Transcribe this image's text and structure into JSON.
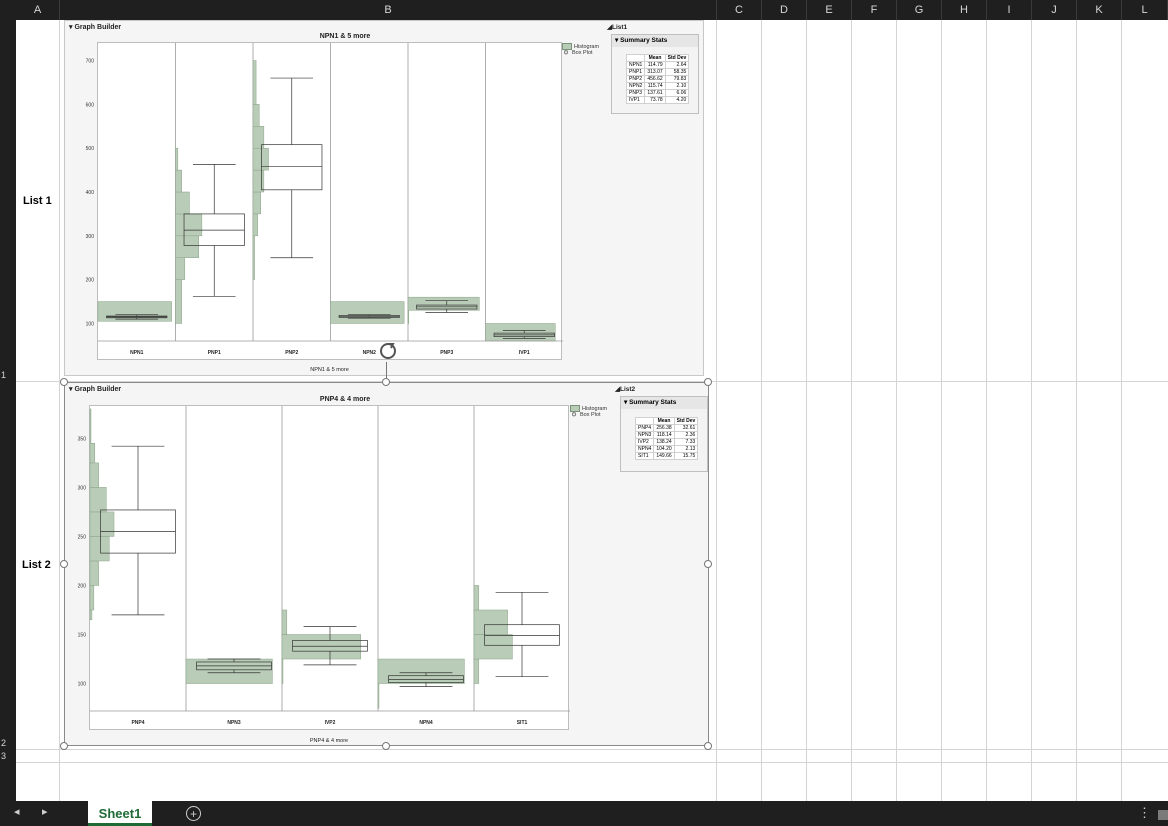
{
  "spreadsheet": {
    "columns": [
      "A",
      "B",
      "C",
      "D",
      "E",
      "F",
      "G",
      "H",
      "I",
      "J",
      "K",
      "L"
    ],
    "rows": [
      "1",
      "2",
      "3"
    ],
    "row_labels": [
      "List 1",
      "List 2"
    ],
    "sheet_tab": "Sheet1"
  },
  "panel1": {
    "header": "Graph Builder",
    "title": "NPN1 & 5 more",
    "footer": "NPN1 & 5 more",
    "legend": [
      "Histogram",
      "Box Plot"
    ],
    "list_label": "List1",
    "stats_title": "Summary Stats",
    "stats_headers": [
      "",
      "Mean",
      "Std Dev"
    ],
    "stats_rows": [
      [
        "NPN1",
        "114.79",
        "2.64"
      ],
      [
        "PNP1",
        "313.07",
        "58.35"
      ],
      [
        "PNP2",
        "456.62",
        "79.83"
      ],
      [
        "NPN2",
        "115.74",
        "2.10"
      ],
      [
        "PNP3",
        "137.61",
        "6.06"
      ],
      [
        "IVP1",
        "73.78",
        "4.20"
      ]
    ]
  },
  "panel2": {
    "header": "Graph Builder",
    "title": "PNP4 & 4 more",
    "footer": "PNP4 & 4 more",
    "legend": [
      "Histogram",
      "Box Plot"
    ],
    "list_label": "List2",
    "stats_title": "Summary Stats",
    "stats_headers": [
      "",
      "Mean",
      "Std Dev"
    ],
    "stats_rows": [
      [
        "PNP4",
        "256.38",
        "32.61"
      ],
      [
        "NPN3",
        "118.14",
        "2.36"
      ],
      [
        "IVP2",
        "138.24",
        "7.33"
      ],
      [
        "NPN4",
        "104.20",
        "2.13"
      ],
      [
        "SIT1",
        "149.66",
        "15.75"
      ]
    ]
  },
  "chart_data": [
    {
      "type": "box",
      "title": "NPN1 & 5 more",
      "xlabel": "NPN1 & 5 more",
      "ylabel": "",
      "ylim": [
        60,
        740
      ],
      "yticks": [
        100,
        200,
        300,
        400,
        500,
        600,
        700
      ],
      "legend": [
        "Histogram",
        "Box Plot"
      ],
      "legend_position": "top-right",
      "categories": [
        "NPN1",
        "PNP1",
        "PNP2",
        "NPN2",
        "PNP3",
        "IVP1"
      ],
      "boxes": [
        {
          "name": "NPN1",
          "min": 110,
          "q1": 113,
          "median": 115,
          "q3": 117,
          "max": 120
        },
        {
          "name": "PNP1",
          "min": 162,
          "q1": 278,
          "median": 313,
          "q3": 350,
          "max": 463
        },
        {
          "name": "PNP2",
          "min": 250,
          "q1": 405,
          "median": 458,
          "q3": 508,
          "max": 660
        },
        {
          "name": "NPN2",
          "min": 112,
          "q1": 114,
          "median": 116,
          "q3": 118,
          "max": 120
        },
        {
          "name": "PNP3",
          "min": 125,
          "q1": 133,
          "median": 138,
          "q3": 142,
          "max": 152
        },
        {
          "name": "IVP1",
          "min": 66,
          "q1": 70,
          "median": 74,
          "q3": 78,
          "max": 84
        }
      ],
      "histograms": [
        {
          "name": "NPN1",
          "bins": [
            {
              "lo": 105,
              "hi": 150,
              "w": 0.95
            }
          ]
        },
        {
          "name": "PNP1",
          "bins": [
            {
              "lo": 100,
              "hi": 200,
              "w": 0.08
            },
            {
              "lo": 200,
              "hi": 250,
              "w": 0.12
            },
            {
              "lo": 250,
              "hi": 300,
              "w": 0.3
            },
            {
              "lo": 300,
              "hi": 350,
              "w": 0.34
            },
            {
              "lo": 350,
              "hi": 400,
              "w": 0.18
            },
            {
              "lo": 400,
              "hi": 450,
              "w": 0.08
            },
            {
              "lo": 450,
              "hi": 500,
              "w": 0.03
            }
          ]
        },
        {
          "name": "PNP2",
          "bins": [
            {
              "lo": 200,
              "hi": 300,
              "w": 0.02
            },
            {
              "lo": 300,
              "hi": 350,
              "w": 0.06
            },
            {
              "lo": 350,
              "hi": 400,
              "w": 0.1
            },
            {
              "lo": 400,
              "hi": 450,
              "w": 0.14
            },
            {
              "lo": 450,
              "hi": 500,
              "w": 0.2
            },
            {
              "lo": 500,
              "hi": 550,
              "w": 0.14
            },
            {
              "lo": 550,
              "hi": 600,
              "w": 0.08
            },
            {
              "lo": 600,
              "hi": 700,
              "w": 0.04
            }
          ]
        },
        {
          "name": "NPN2",
          "bins": [
            {
              "lo": 100,
              "hi": 150,
              "w": 0.95
            }
          ]
        },
        {
          "name": "PNP3",
          "bins": [
            {
              "lo": 100,
              "hi": 130,
              "w": 0.01
            },
            {
              "lo": 130,
              "hi": 160,
              "w": 0.92
            }
          ]
        },
        {
          "name": "IVP1",
          "bins": [
            {
              "lo": 60,
              "hi": 100,
              "w": 0.9
            }
          ]
        }
      ]
    },
    {
      "type": "box",
      "title": "PNP4 & 4 more",
      "xlabel": "PNP4 & 4 more",
      "ylabel": "",
      "ylim": [
        72,
        383
      ],
      "yticks": [
        100,
        150,
        200,
        250,
        300,
        350
      ],
      "legend": [
        "Histogram",
        "Box Plot"
      ],
      "legend_position": "top-right",
      "categories": [
        "PNP4",
        "NPN3",
        "IVP2",
        "NPN4",
        "SIT1"
      ],
      "boxes": [
        {
          "name": "PNP4",
          "min": 170,
          "q1": 233,
          "median": 255,
          "q3": 277,
          "max": 342
        },
        {
          "name": "NPN3",
          "min": 111,
          "q1": 114,
          "median": 118,
          "q3": 122,
          "max": 125
        },
        {
          "name": "IVP2",
          "min": 119,
          "q1": 133,
          "median": 138,
          "q3": 144,
          "max": 158
        },
        {
          "name": "NPN4",
          "min": 97,
          "q1": 101,
          "median": 104,
          "q3": 108,
          "max": 111
        },
        {
          "name": "SIT1",
          "min": 107,
          "q1": 139,
          "median": 149,
          "q3": 160,
          "max": 193
        }
      ],
      "histograms": [
        {
          "name": "PNP4",
          "bins": [
            {
              "lo": 165,
              "hi": 175,
              "w": 0.02
            },
            {
              "lo": 175,
              "hi": 200,
              "w": 0.04
            },
            {
              "lo": 200,
              "hi": 225,
              "w": 0.09
            },
            {
              "lo": 225,
              "hi": 250,
              "w": 0.2
            },
            {
              "lo": 250,
              "hi": 275,
              "w": 0.25
            },
            {
              "lo": 275,
              "hi": 300,
              "w": 0.17
            },
            {
              "lo": 300,
              "hi": 325,
              "w": 0.09
            },
            {
              "lo": 325,
              "hi": 345,
              "w": 0.05
            },
            {
              "lo": 345,
              "hi": 380,
              "w": 0.01
            }
          ]
        },
        {
          "name": "NPN3",
          "bins": [
            {
              "lo": 100,
              "hi": 125,
              "w": 0.9
            }
          ]
        },
        {
          "name": "IVP2",
          "bins": [
            {
              "lo": 100,
              "hi": 125,
              "w": 0.01
            },
            {
              "lo": 125,
              "hi": 150,
              "w": 0.82
            },
            {
              "lo": 150,
              "hi": 175,
              "w": 0.05
            }
          ]
        },
        {
          "name": "NPN4",
          "bins": [
            {
              "lo": 75,
              "hi": 100,
              "w": 0.01
            },
            {
              "lo": 100,
              "hi": 125,
              "w": 0.9
            }
          ]
        },
        {
          "name": "SIT1",
          "bins": [
            {
              "lo": 100,
              "hi": 125,
              "w": 0.05
            },
            {
              "lo": 125,
              "hi": 150,
              "w": 0.4
            },
            {
              "lo": 150,
              "hi": 175,
              "w": 0.35
            },
            {
              "lo": 175,
              "hi": 200,
              "w": 0.05
            }
          ]
        }
      ]
    }
  ]
}
